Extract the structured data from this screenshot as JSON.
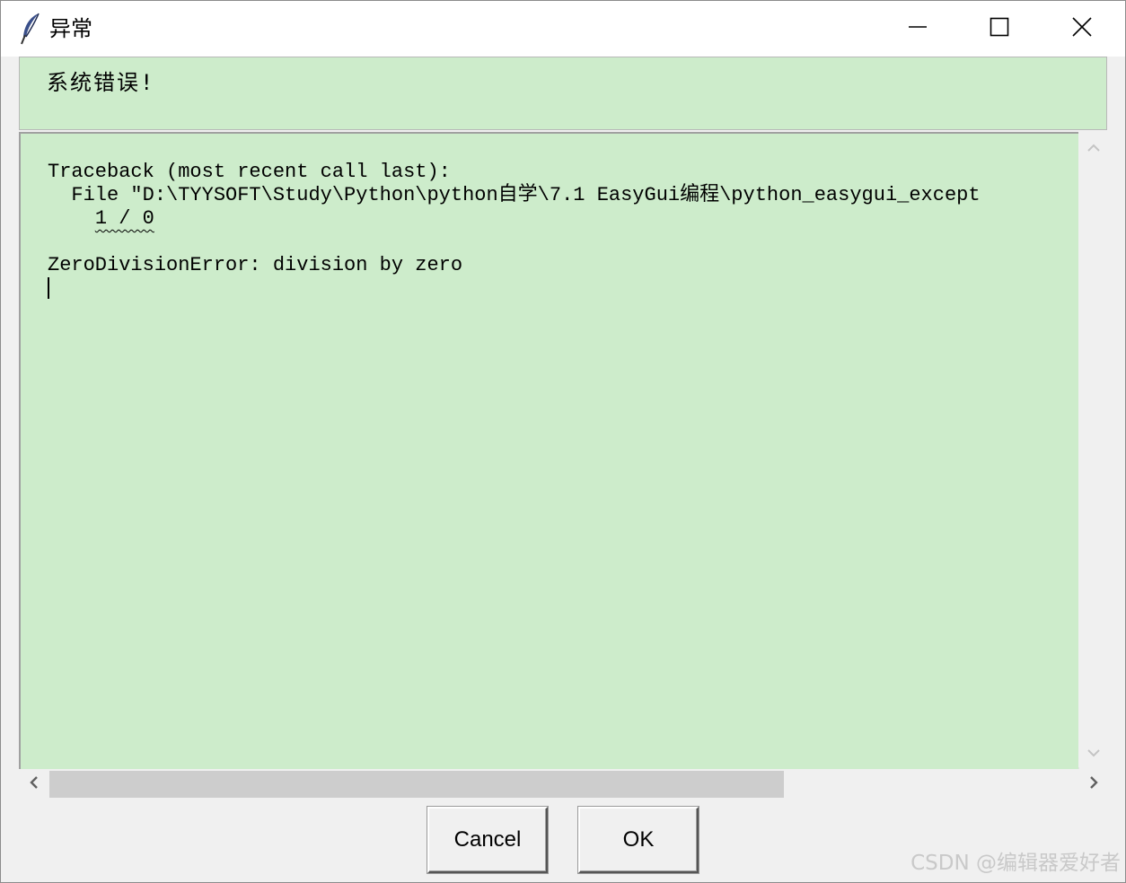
{
  "window": {
    "title": "异常",
    "icon": "feather-icon",
    "controls": {
      "minimize_icon": "minimize-icon",
      "maximize_icon": "maximize-icon",
      "close_icon": "close-icon"
    }
  },
  "message": "系统错误!",
  "text_area": {
    "lines": [
      "Traceback (most recent call last):",
      "  File \"D:\\TYYSOFT\\Study\\Python\\python自学\\7.1 EasyGui编程\\python_easygui_except",
      "    1 / 0",
      "",
      "ZeroDivisionError: division by zero"
    ],
    "background_color": "#cdeccb"
  },
  "scrollbars": {
    "vertical": {
      "up_icon": "chevron-up-icon",
      "down_icon": "chevron-down-icon"
    },
    "horizontal": {
      "left_icon": "chevron-left-icon",
      "right_icon": "chevron-right-icon"
    }
  },
  "buttons": {
    "cancel": "Cancel",
    "ok": "OK"
  },
  "watermark": "CSDN @编辑器爱好者"
}
